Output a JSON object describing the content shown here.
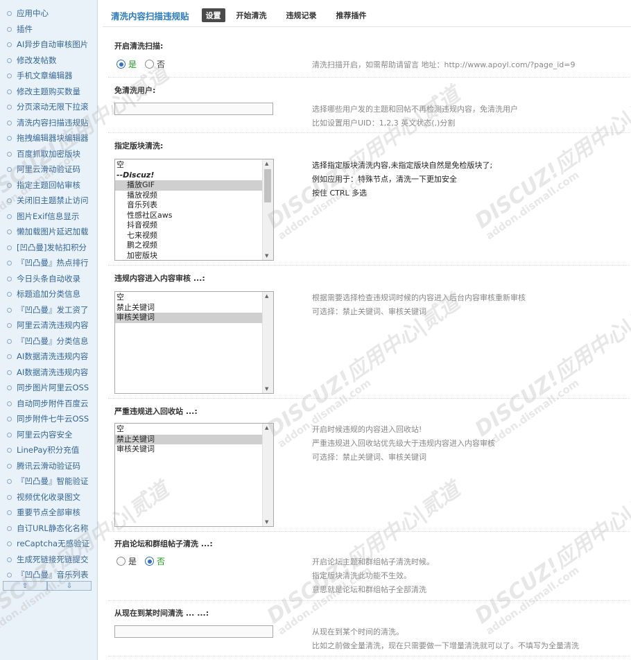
{
  "sidebar": {
    "items": [
      "应用中心",
      "插件",
      "AI异步自动审核图片",
      "修改发帖数",
      "手机文章编辑器",
      "修改主题购买数量",
      "分页滚动无限下拉滚",
      "清洗内容扫描违规贴",
      "拖拽编辑器块编辑器",
      "百度抓取加密版块",
      "阿里云滑动验证码",
      "指定主题回帖审核",
      "关闭旧主题禁止访问",
      "图片Exif信息显示",
      "懒加载图片延迟加载",
      "[凹凸曼]发帖扣积分",
      "『凹凸曼』热点排行",
      "今日头条自动收录",
      "标题追加分类信息",
      "『凹凸曼』发工资了",
      "阿里云清洗违规内容",
      "『凹凸曼』分类信息",
      "AI数据清洗违规内容",
      "AI数据清洗违规内容",
      "同步图片阿里云OSS",
      "自动同步附件百度云",
      "同步附件七牛云OSS",
      "阿里云内容安全",
      "LinePay积分充值",
      "腾讯云滑动验证码",
      "『凹凸曼』智能验证",
      "视频优化收录图文",
      "重要节点全部审核",
      "自订URL静态化名称",
      "reCaptcha无感验证",
      "生成死链接死链提交",
      "『凹凸曼』音乐列表"
    ],
    "scroll_up": "⇧",
    "scroll_down": "⇩"
  },
  "nav": {
    "title": "清洗内容扫描违规贴",
    "tabs": [
      "设置",
      "开始清洗",
      "违规记录",
      "推荐插件"
    ]
  },
  "s1": {
    "title": "开启清洗扫描:",
    "yes": "是",
    "no": "否",
    "desc": "清洗扫描开启，如需帮助请留言 地址：http://www.apoyl.com/?page_id=9"
  },
  "s2": {
    "title": "免清洗用户:",
    "value": "",
    "desc1": "选择哪些用户发的主题和回帖不再检测违规内容，免清洗用户",
    "desc2": "比如设置用户UID：1,2,3 英文状态(,)分割"
  },
  "s3": {
    "title": "指定版块清洗:",
    "options": [
      "空",
      "--Discuz!",
      "播放GIF",
      "播放视频",
      "音乐列表",
      "性感社区aws",
      "抖音视频",
      "七来视频",
      "鹏之视频",
      "加密版块"
    ],
    "desc1": "选择指定版块清洗内容,未指定版块自然是免检版块了;",
    "desc2": "例如应用于：特殊节点，清洗一下更加安全",
    "desc3": "按住 CTRL 多选"
  },
  "s4": {
    "title": "违规内容进入内容审核 ...:",
    "options": [
      "空",
      "禁止关键词",
      "审核关键词"
    ],
    "desc1": "根据需要选择检查违规词时候的内容进入后台内容审核重新审核",
    "desc2": "可选择：禁止关键词、审核关键词"
  },
  "s5": {
    "title": "严重违规进入回收站 ...:",
    "options": [
      "空",
      "禁止关键词",
      "审核关键词"
    ],
    "desc1": "开启时候违规的内容进入回收站!",
    "desc2": "严重违规进入回收站优先级大于违规内容进入内容审核",
    "desc3": "可选择：禁止关键词、审核关键词"
  },
  "s6": {
    "title": "开启论坛和群组帖子清洗 ...:",
    "yes": "是",
    "no": "否",
    "desc1": "开启论坛主题和群组帖子清洗时候。",
    "desc2": "指定版块清洗此功能不生效。",
    "desc3": "意思就是论坛和群组帖子全部清洗"
  },
  "s7": {
    "title": "从现在到某时间清洗 ... ...:",
    "value": "",
    "desc1": "从现在到某个时间的清洗。",
    "desc2": "比如之前做全量清洗，现在只需要做一下增量清洗就可以了。不填写为全量清洗"
  },
  "watermark": {
    "line1": "DISCUZ!应用中心|贰道",
    "line2": "addon.dismall.com"
  }
}
